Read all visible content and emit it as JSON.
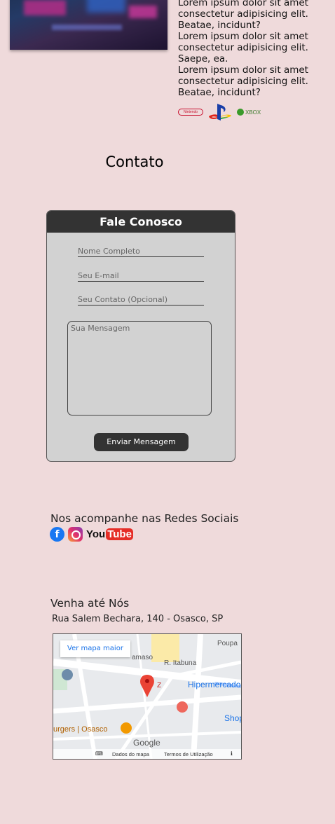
{
  "about": {
    "paragraphs": [
      "Lorem ipsum dolor sit amet consectetur adipisicing elit. Beatae, incidunt?",
      "Lorem ipsum dolor sit amet consectetur adipisicing elit. Saepe, ea.",
      "Lorem ipsum dolor sit amet consectetur adipisicing elit. Beatae, incidunt?"
    ],
    "brands": {
      "nintendo": "Nintendo",
      "xbox": "XBOX"
    }
  },
  "contact": {
    "title": "Contato",
    "form_title": "Fale Conosco",
    "name_placeholder": "Nome Completo",
    "email_placeholder": "Seu E-mail",
    "phone_placeholder": "Seu Contato (Opcional)",
    "message_placeholder": "Sua Mensagem",
    "submit_label": "Enviar Mensagem"
  },
  "social": {
    "title": "Nos acompanhe nas Redes Sociais",
    "youtube_you": "You",
    "youtube_tube": "Tube",
    "facebook_letter": "f"
  },
  "location": {
    "title": "Venha até Nós",
    "address": "Rua Salem Bechara, 140 - Osasco, SP",
    "map": {
      "bigger_map_link": "Ver mapa maior",
      "labels": {
        "poupa": "Poupa",
        "hipermercado": "Hipermercado",
        "shop": "Shop",
        "street_itabuna": "R. Itabuna",
        "street_amaso": "amaso",
        "burgers": "urgers | Osasco",
        "marker_letter": "Z"
      },
      "google": "Google",
      "map_data": "Dados do mapa",
      "terms": "Termos de Utilização"
    }
  }
}
